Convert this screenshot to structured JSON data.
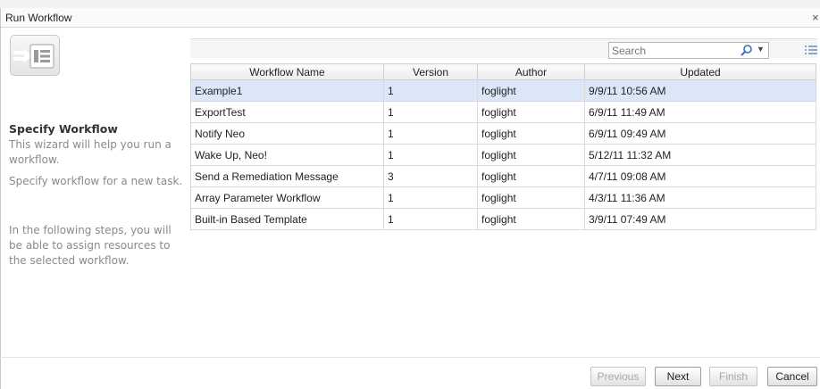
{
  "window": {
    "title": "Run Workflow",
    "close_glyph": "×"
  },
  "wizard": {
    "icon": "workflow-wizard-icon",
    "step_title": "Specify Workflow",
    "text1": "This wizard will help you run a workflow.",
    "text2": "Specify workflow for a new task.",
    "text3": "In the following steps, you will be able to assign resources to the selected workflow."
  },
  "toolbar": {
    "search_placeholder": "Search",
    "search_icon": "search-icon",
    "options_icon": "column-options-icon"
  },
  "table": {
    "columns": [
      "Workflow Name",
      "Version",
      "Author",
      "Updated"
    ],
    "selected_row": 0,
    "rows": [
      [
        "Example1",
        "1",
        "foglight",
        "9/9/11 10:56 AM"
      ],
      [
        "ExportTest",
        "1",
        "foglight",
        "6/9/11 11:49 AM"
      ],
      [
        "Notify Neo",
        "1",
        "foglight",
        "6/9/11 09:49 AM"
      ],
      [
        "Wake Up, Neo!",
        "1",
        "foglight",
        "5/12/11 11:32 AM"
      ],
      [
        "Send a Remediation Message",
        "3",
        "foglight",
        "4/7/11 09:08 AM"
      ],
      [
        "Array Parameter Workflow",
        "1",
        "foglight",
        "4/3/11 11:36 AM"
      ],
      [
        "Built-in Based Template",
        "1",
        "foglight",
        "3/9/11 07:49 AM"
      ]
    ]
  },
  "buttons": {
    "previous": "Previous",
    "next": "Next",
    "finish": "Finish",
    "cancel": "Cancel"
  },
  "colors": {
    "selected_row": "#dbe7f6",
    "disabled_text": "#a8a8a8"
  }
}
